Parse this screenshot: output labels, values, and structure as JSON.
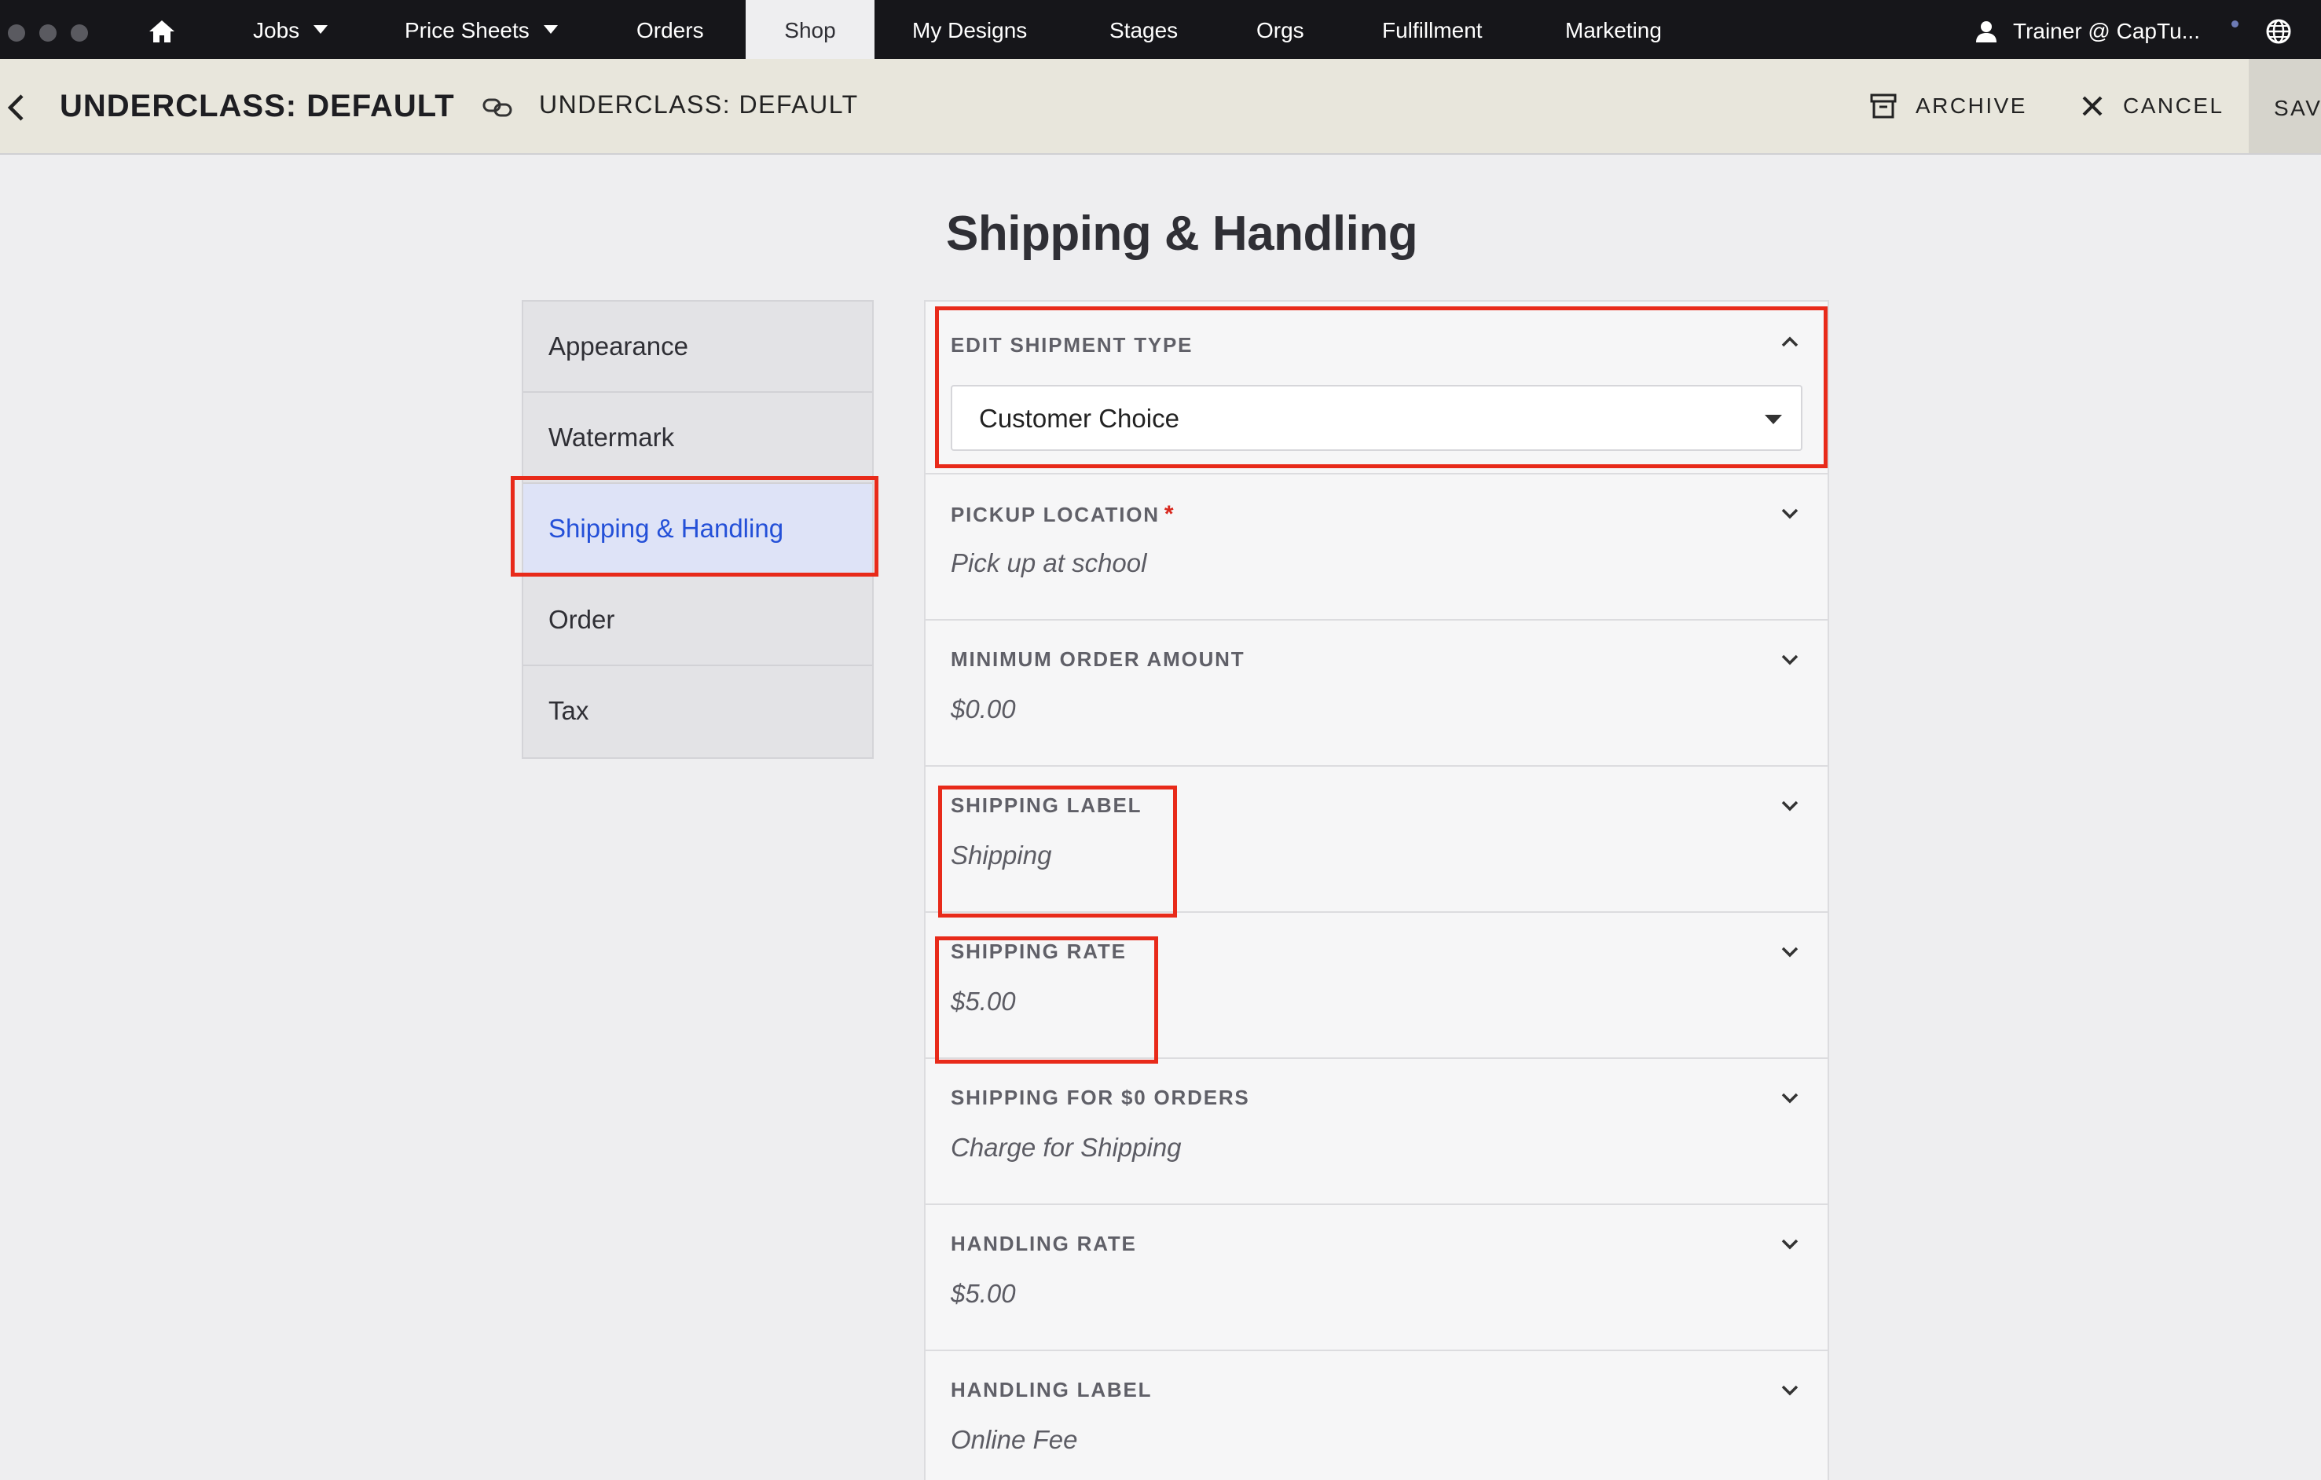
{
  "nav": {
    "items": [
      {
        "label": "Jobs"
      },
      {
        "label": "Price Sheets"
      },
      {
        "label": "Orders"
      },
      {
        "label": "Shop"
      },
      {
        "label": "My Designs"
      },
      {
        "label": "Stages"
      },
      {
        "label": "Orgs"
      },
      {
        "label": "Fulfillment"
      },
      {
        "label": "Marketing"
      }
    ],
    "active": "Shop",
    "user": "Trainer @ CapTu...",
    "icons": [
      "home-icon",
      "user-icon",
      "globe-icon"
    ]
  },
  "header": {
    "title": "UNDERCLASS: DEFAULT",
    "subtitle": "UNDERCLASS: DEFAULT",
    "archive_label": "ARCHIVE",
    "cancel_label": "CANCEL",
    "save_label": "SAVE"
  },
  "page": {
    "title": "Shipping & Handling"
  },
  "sidebar": {
    "items": [
      {
        "label": "Appearance"
      },
      {
        "label": "Watermark"
      },
      {
        "label": "Shipping & Handling"
      },
      {
        "label": "Order"
      },
      {
        "label": "Tax"
      }
    ],
    "active": "Shipping & Handling"
  },
  "form": {
    "shipment_type": {
      "label": "EDIT SHIPMENT TYPE",
      "value": "Customer Choice"
    },
    "sections": [
      {
        "label": "PICKUP LOCATION",
        "required_mark": "*",
        "value": "Pick up at school"
      },
      {
        "label": "MINIMUM ORDER AMOUNT",
        "value": "$0.00"
      },
      {
        "label": "SHIPPING LABEL",
        "value": "Shipping"
      },
      {
        "label": "SHIPPING RATE",
        "value": "$5.00"
      },
      {
        "label": "SHIPPING FOR $0 ORDERS",
        "value": "Charge for Shipping"
      },
      {
        "label": "HANDLING RATE",
        "value": "$5.00"
      },
      {
        "label": "HANDLING LABEL",
        "value": "Online Fee"
      }
    ]
  },
  "colors": {
    "nav_bg": "#16161a",
    "header_bg": "#e8e6dc",
    "accent": "#2450d8",
    "highlight_box": "#e82a1a",
    "required": "#d8281e"
  }
}
